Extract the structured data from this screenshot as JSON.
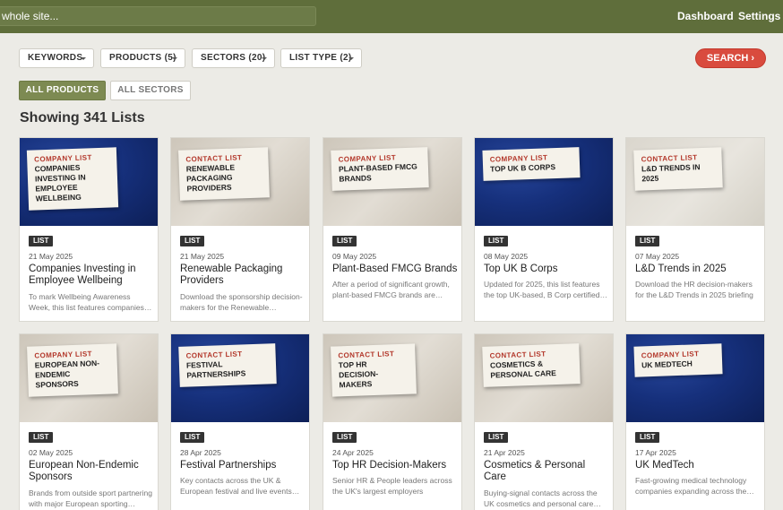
{
  "topbar": {
    "search_value": "whole site...",
    "dashboard_label": "Dashboard",
    "settings_label": "Settings"
  },
  "filters": {
    "keywords": "KEYWORDS",
    "products": "PRODUCTS (5)",
    "sectors": "SECTORS (20)",
    "list_type": "LIST TYPE (2)",
    "search_button": "SEARCH ›"
  },
  "pills": {
    "all_products": "ALL PRODUCTS",
    "all_sectors": "ALL SECTORS"
  },
  "heading": "Showing 341 Lists",
  "cards": [
    {
      "type": "COMPANY LIST",
      "label_title": "COMPANIES INVESTING IN EMPLOYEE WELLBEING",
      "tag": "LIST",
      "date": "21 May 2025",
      "title": "Companies Investing in Employee Wellbeing",
      "desc": "To mark Wellbeing Awareness Week, this list features companies…"
    },
    {
      "type": "CONTACT LIST",
      "label_title": "RENEWABLE PACKAGING PROVIDERS",
      "tag": "LIST",
      "date": "21 May 2025",
      "title": "Renewable Packaging Providers",
      "desc": "Download the sponsorship decision-makers for the Renewable…"
    },
    {
      "type": "COMPANY LIST",
      "label_title": "PLANT-BASED FMCG BRANDS",
      "tag": "LIST",
      "date": "09 May 2025",
      "title": "Plant-Based FMCG Brands",
      "desc": "After a period of significant growth, plant-based FMCG brands are…"
    },
    {
      "type": "COMPANY LIST",
      "label_title": "TOP UK B CORPS",
      "tag": "LIST",
      "date": "08 May 2025",
      "title": "Top UK B Corps",
      "desc": "Updated for 2025, this list features the top UK-based, B Corp certified…"
    },
    {
      "type": "CONTACT LIST",
      "label_title": "L&D TRENDS IN 2025",
      "tag": "LIST",
      "date": "07 May 2025",
      "title": "L&D Trends in 2025",
      "desc": "Download the HR decision-makers for the L&D Trends in 2025 briefing"
    },
    {
      "type": "COMPANY LIST",
      "label_title": "EUROPEAN NON-ENDEMIC SPONSORS",
      "tag": "LIST",
      "date": "02 May 2025",
      "title": "European Non-Endemic Sponsors",
      "desc": "Brands from outside sport partnering with major European sporting…"
    },
    {
      "type": "CONTACT LIST",
      "label_title": "FESTIVAL PARTNERSHIPS",
      "tag": "LIST",
      "date": "28 Apr 2025",
      "title": "Festival Partnerships",
      "desc": "Key contacts across the UK & European festival and live events…"
    },
    {
      "type": "CONTACT LIST",
      "label_title": "TOP HR DECISION-MAKERS",
      "tag": "LIST",
      "date": "24 Apr 2025",
      "title": "Top HR Decision-Makers",
      "desc": "Senior HR & People leaders across the UK's largest employers"
    },
    {
      "type": "CONTACT LIST",
      "label_title": "COSMETICS & PERSONAL CARE",
      "tag": "LIST",
      "date": "21 Apr 2025",
      "title": "Cosmetics & Personal Care",
      "desc": "Buying-signal contacts across the UK cosmetics and personal care…"
    },
    {
      "type": "COMPANY LIST",
      "label_title": "UK MEDTECH",
      "tag": "LIST",
      "date": "17 Apr 2025",
      "title": "UK MedTech",
      "desc": "Fast-growing medical technology companies expanding across the…"
    }
  ]
}
